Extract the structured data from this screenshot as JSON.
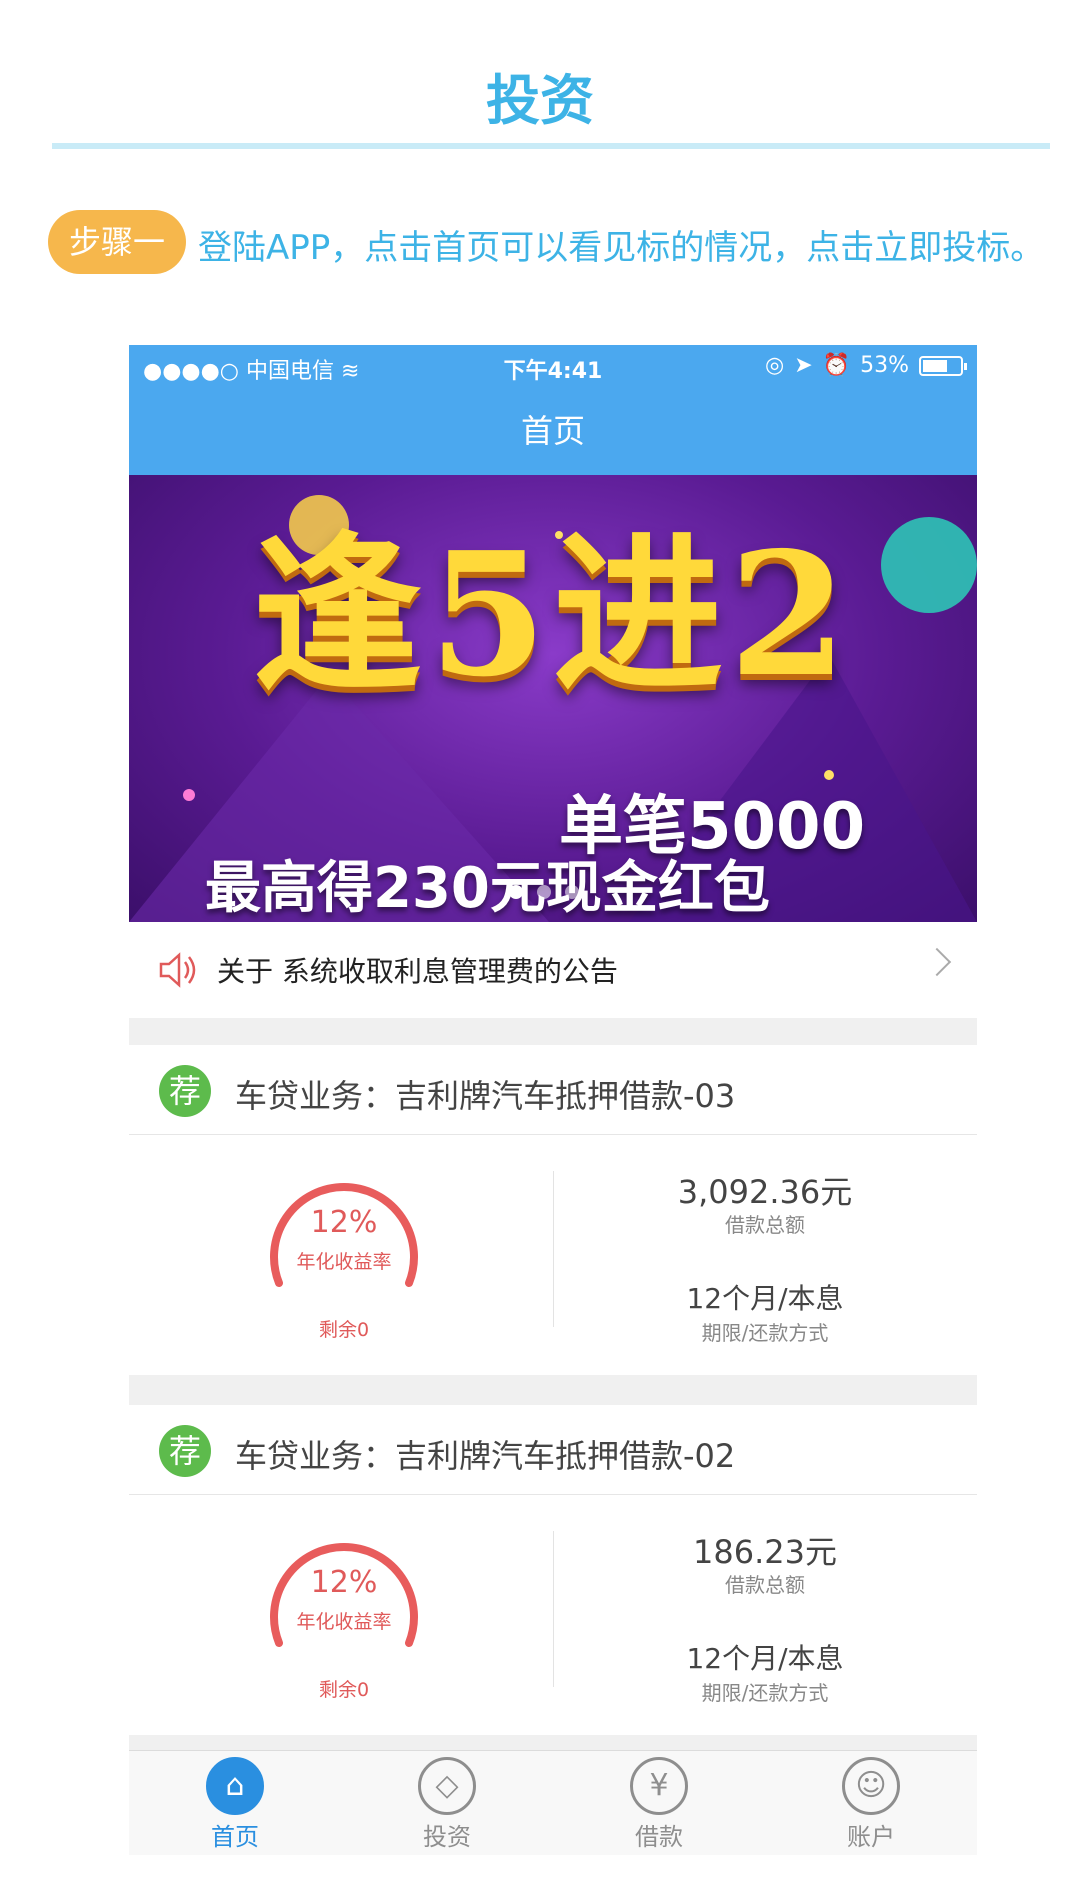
{
  "page": {
    "heading": "投资",
    "step_badge": "步骤一",
    "step_text": "登陆APP，点击首页可以看见标的情况，点击立即投标。"
  },
  "status_bar": {
    "left": "●●●●○ 中国电信 ≋",
    "time": "下午4:41",
    "battery": "53%"
  },
  "nav": {
    "title": "首页"
  },
  "banner": {
    "title": "逢5进2",
    "line1": "单笔5000",
    "line2": "最高得230元现金红包",
    "slide_count": 3,
    "active_slide": 1
  },
  "notice": {
    "text": "关于       系统收取利息管理费的公告"
  },
  "loans": [
    {
      "badge": "荐",
      "title": "车贷业务：吉利牌汽车抵押借款-03",
      "rate": "12%",
      "rate_label": "年化收益率",
      "remain": "剩余0",
      "amount": "3,092.36元",
      "amount_label": "借款总额",
      "term": "12个月/本息",
      "term_label": "期限/还款方式"
    },
    {
      "badge": "荐",
      "title": "车贷业务：吉利牌汽车抵押借款-02",
      "rate": "12%",
      "rate_label": "年化收益率",
      "remain": "剩余0",
      "amount": "186.23元",
      "amount_label": "借款总额",
      "term": "12个月/本息",
      "term_label": "期限/还款方式"
    }
  ],
  "tabs": [
    {
      "label": "首页",
      "icon": "home-icon",
      "glyph": "⌂",
      "active": true
    },
    {
      "label": "投资",
      "icon": "invest-icon",
      "glyph": "◇",
      "active": false
    },
    {
      "label": "借款",
      "icon": "yen-icon",
      "glyph": "¥",
      "active": false
    },
    {
      "label": "账户",
      "icon": "user-icon",
      "glyph": "☺",
      "active": false
    }
  ],
  "colors": {
    "brand_blue": "#4ba8ef",
    "heading_blue": "#3db3e6",
    "step_orange": "#f6b74c",
    "rate_red": "#e05a5a",
    "badge_green": "#5dbb4c"
  }
}
